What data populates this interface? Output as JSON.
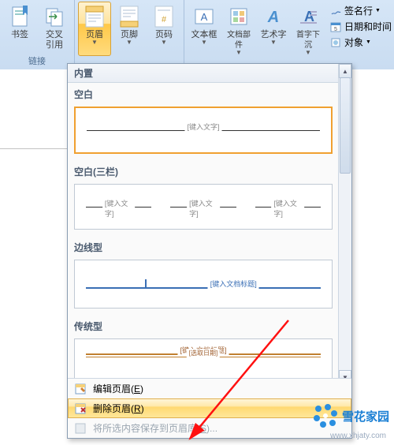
{
  "ribbon": {
    "groups": {
      "links": {
        "label": "链接",
        "bookmark": "书签",
        "crossref": "交叉\n引用"
      },
      "headerfooter": {
        "header": "页眉",
        "footer": "页脚",
        "pagenum": "页码"
      },
      "text": {
        "textbox": "文本框",
        "parts": "文档部件",
        "wordart": "艺术字",
        "dropcap": "首字下沉"
      },
      "extras": {
        "sig": "签名行",
        "datetime": "日期和时间",
        "object": "对象"
      }
    }
  },
  "gallery": {
    "builtin": "内置",
    "blank": "空白",
    "blank3": "空白(三栏)",
    "edge": "边线型",
    "traditional": "传统型",
    "ph_text": "[键入文字]",
    "ph_doctitle": "[键入文档标题]",
    "ph_date": "[选取日期]"
  },
  "menu": {
    "edit": "编辑页眉",
    "edit_accel": "E",
    "remove": "删除页眉",
    "remove_accel": "R",
    "save": "将所选内容保存到页眉库",
    "save_accel": "S"
  },
  "watermark": {
    "name": "雪花家园",
    "url": "www.xhjaty.com"
  }
}
